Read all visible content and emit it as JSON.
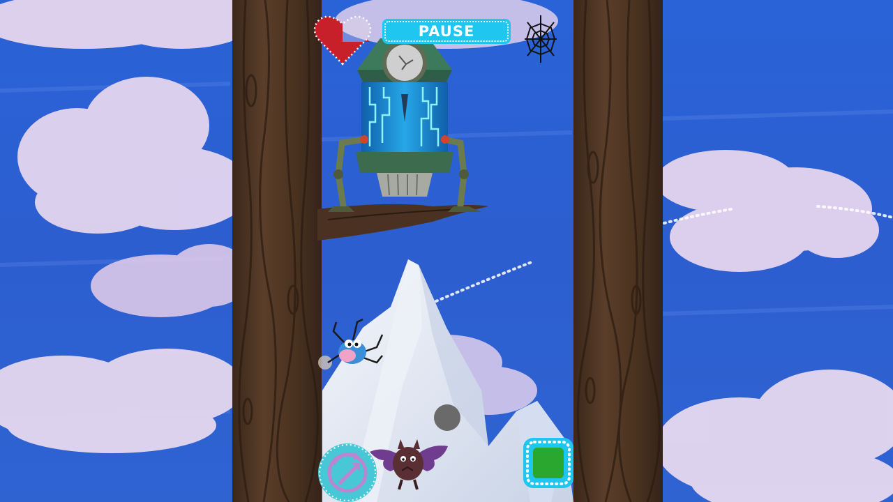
{
  "hud": {
    "pause_label": "PAUSE",
    "health_fraction": 0.75
  },
  "icons": {
    "heart": "heart-health-icon",
    "web": "spider-web-icon",
    "swap": "swap-arrows-icon",
    "action": "green-square-icon"
  },
  "colors": {
    "sky": "#2e5fd6",
    "pause_bg": "#1fc7f0",
    "heart": "#c8202a",
    "bark": "#4e3523",
    "action_green": "#29a72e"
  }
}
